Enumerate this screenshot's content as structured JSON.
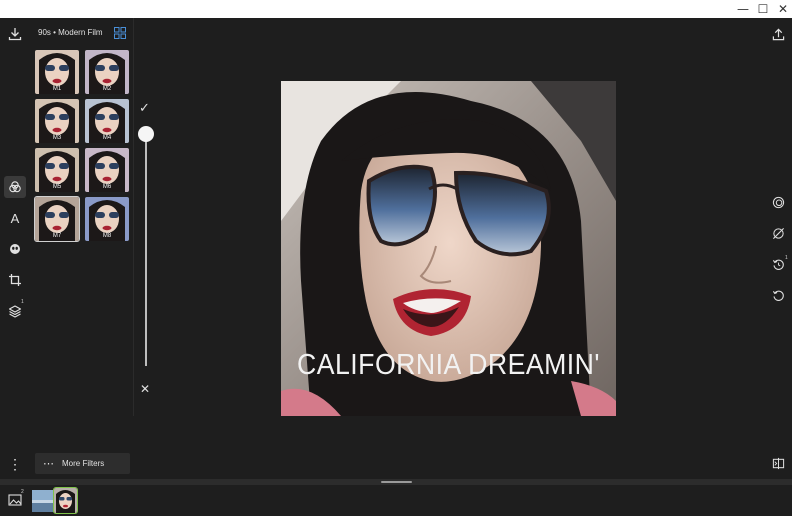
{
  "window": {
    "minimize_glyph": "—",
    "maximize_glyph": "☐",
    "close_glyph": "✕"
  },
  "left_toolbar": {
    "items": [
      {
        "name": "download-icon"
      },
      {
        "name": "filters-icon",
        "active": true
      },
      {
        "name": "text-icon",
        "glyph": "A"
      },
      {
        "name": "sticker-icon"
      },
      {
        "name": "crop-icon"
      },
      {
        "name": "layers-icon",
        "badge": "1"
      }
    ],
    "menu_glyph": "⋮"
  },
  "filter_panel": {
    "title": "90s • Modern Film",
    "thumbnails": [
      {
        "label": "M1",
        "selected": false
      },
      {
        "label": "M2",
        "selected": false
      },
      {
        "label": "M3",
        "selected": false
      },
      {
        "label": "M4",
        "selected": false
      },
      {
        "label": "M5",
        "selected": false
      },
      {
        "label": "M6",
        "selected": false
      },
      {
        "label": "M7",
        "selected": true
      },
      {
        "label": "M8",
        "selected": false
      }
    ],
    "more_filters_label": "More Filters",
    "more_glyph": "⋯"
  },
  "strength_slider": {
    "value": 1.0,
    "confirm_glyph": "✓",
    "cancel_glyph": "✕"
  },
  "canvas": {
    "caption": "CALIFORNIA DREAMIN'"
  },
  "right_toolbar": {
    "items": [
      {
        "name": "vignette-icon"
      },
      {
        "name": "remove-effect-icon"
      },
      {
        "name": "undo-history-icon",
        "badge": "1"
      },
      {
        "name": "undo-icon"
      },
      {
        "name": "compare-icon"
      }
    ]
  },
  "filmstrip": {
    "gallery_badge": "2",
    "items": [
      {
        "name": "thumbnail-landscape",
        "selected": false
      },
      {
        "name": "thumbnail-portrait",
        "selected": true
      }
    ]
  },
  "colors": {
    "background": "#1e1e1e",
    "panel": "#2d2d2d",
    "accent": "#4a90d9",
    "selected_outline": "#7fc24a"
  }
}
